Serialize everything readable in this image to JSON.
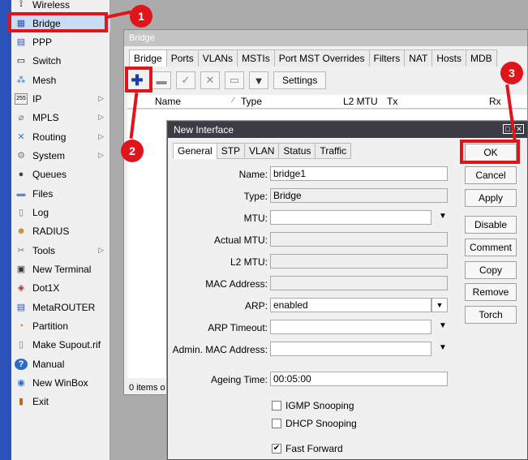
{
  "menu": [
    {
      "label": "Wireless",
      "icon": "wireless-icon",
      "glyph": "⟟"
    },
    {
      "label": "Bridge",
      "icon": "bridge-icon",
      "glyph": "▦"
    },
    {
      "label": "PPP",
      "icon": "ppp-icon",
      "glyph": "▤"
    },
    {
      "label": "Switch",
      "icon": "switch-icon",
      "glyph": "▭"
    },
    {
      "label": "Mesh",
      "icon": "mesh-icon",
      "glyph": "⁂"
    },
    {
      "label": "IP",
      "icon": "ip-icon",
      "glyph": "255"
    },
    {
      "label": "MPLS",
      "icon": "mpls-icon",
      "glyph": "⌀"
    },
    {
      "label": "Routing",
      "icon": "routing-icon",
      "glyph": "✕"
    },
    {
      "label": "System",
      "icon": "system-icon",
      "glyph": "⚙"
    },
    {
      "label": "Queues",
      "icon": "queues-icon",
      "glyph": "●"
    },
    {
      "label": "Files",
      "icon": "files-icon",
      "glyph": "▬"
    },
    {
      "label": "Log",
      "icon": "log-icon",
      "glyph": "▯"
    },
    {
      "label": "RADIUS",
      "icon": "radius-icon",
      "glyph": "☻"
    },
    {
      "label": "Tools",
      "icon": "tools-icon",
      "glyph": "✂"
    },
    {
      "label": "New Terminal",
      "icon": "terminal-icon",
      "glyph": "▣"
    },
    {
      "label": "Dot1X",
      "icon": "dot1x-icon",
      "glyph": "◈"
    },
    {
      "label": "MetaROUTER",
      "icon": "metarouter-icon",
      "glyph": "▤"
    },
    {
      "label": "Partition",
      "icon": "partition-icon",
      "glyph": "◔"
    },
    {
      "label": "Make Supout.rif",
      "icon": "supout-icon",
      "glyph": "▯"
    },
    {
      "label": "Manual",
      "icon": "manual-icon",
      "glyph": "?"
    },
    {
      "label": "New WinBox",
      "icon": "winbox-icon",
      "glyph": "◉"
    },
    {
      "label": "Exit",
      "icon": "exit-icon",
      "glyph": "▮"
    }
  ],
  "bridge_window": {
    "title": "Bridge",
    "tabs": [
      "Bridge",
      "Ports",
      "VLANs",
      "MSTIs",
      "Port MST Overrides",
      "Filters",
      "NAT",
      "Hosts",
      "MDB"
    ],
    "settings_label": "Settings",
    "columns": [
      "Name",
      "Type",
      "L2 MTU",
      "Tx",
      "Rx"
    ],
    "status": "0 items o"
  },
  "dialog": {
    "title": "New Interface",
    "tabs": [
      "General",
      "STP",
      "VLAN",
      "Status",
      "Traffic"
    ],
    "fields": {
      "name_label": "Name:",
      "name_value": "bridge1",
      "type_label": "Type:",
      "type_value": "Bridge",
      "mtu_label": "MTU:",
      "actual_mtu_label": "Actual MTU:",
      "l2mtu_label": "L2 MTU:",
      "mac_label": "MAC Address:",
      "arp_label": "ARP:",
      "arp_value": "enabled",
      "arp_timeout_label": "ARP Timeout:",
      "admin_mac_label": "Admin. MAC Address:",
      "ageing_label": "Ageing Time:",
      "ageing_value": "00:05:00"
    },
    "checkboxes": {
      "igmp": "IGMP Snooping",
      "dhcp": "DHCP Snooping",
      "fast_forward": "Fast Forward"
    },
    "buttons": [
      "OK",
      "Cancel",
      "Apply",
      "Disable",
      "Comment",
      "Copy",
      "Remove",
      "Torch"
    ]
  },
  "annotations": [
    "1",
    "2",
    "3"
  ],
  "colors": {
    "highlight": "#e0151b",
    "accent": "#2a52b8"
  }
}
